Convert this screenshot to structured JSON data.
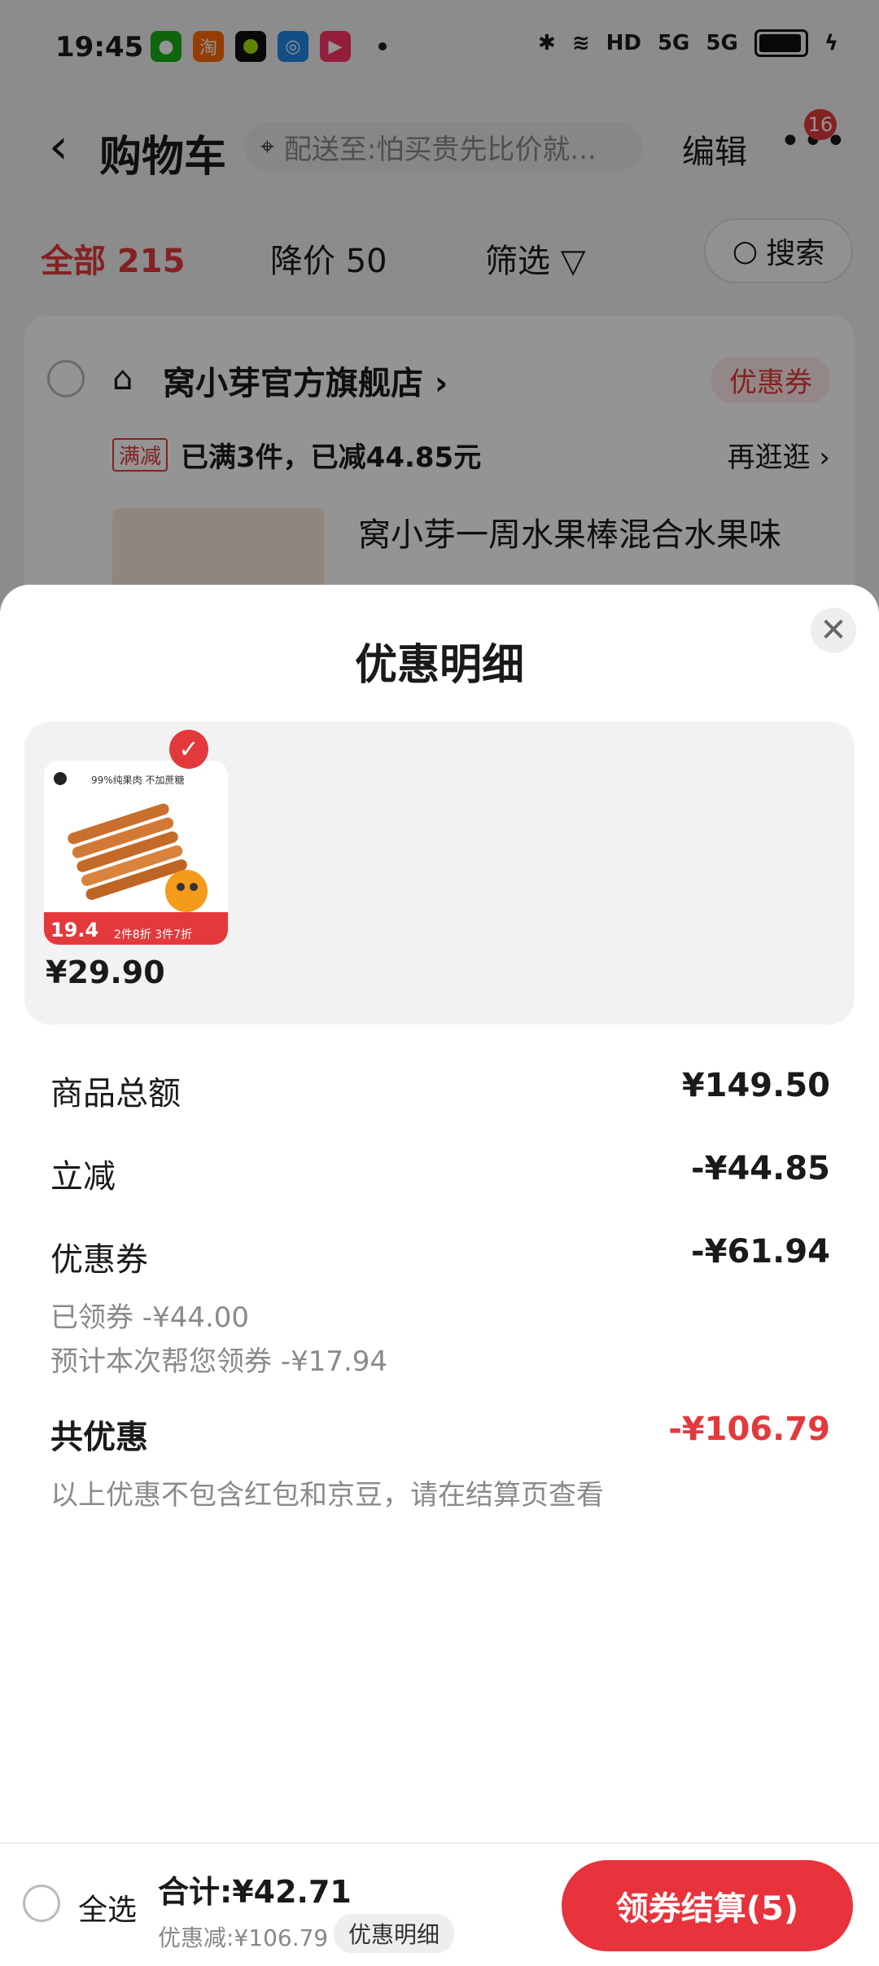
{
  "status_bar": {
    "time": "19:45",
    "network": "5G",
    "hd_label": "HD"
  },
  "nav": {
    "title": "购物车",
    "address": "配送至:怕买贵先比价就...",
    "edit": "编辑",
    "more_badge": "16"
  },
  "filters": {
    "all": "全部 215",
    "price_drop": "降价 50",
    "filter": "筛选",
    "search": "搜索"
  },
  "store": {
    "name": "窝小芽官方旗舰店",
    "coupon_tag": "优惠券",
    "promo_tag": "满减",
    "promo_text": "已满3件，已减44.85元",
    "more_link": "再逛逛",
    "product_title": "窝小芽一周水果棒混合水果味"
  },
  "sheet": {
    "title": "优惠明细",
    "product": {
      "price": "¥29.90",
      "img_text1": "99%纯果肉 不加蔗糖",
      "img_badge": "19.4",
      "img_promo": "2件8折 3件7折"
    },
    "rows": [
      {
        "label": "商品总额",
        "value": "¥149.50"
      },
      {
        "label": "立减",
        "value": "-¥44.85"
      },
      {
        "label": "优惠券",
        "value": "-¥61.94"
      }
    ],
    "coupon_sub": [
      "已领券 -¥44.00",
      "预计本次帮您领券 -¥17.94"
    ],
    "total_label": "共优惠",
    "total_value": "-¥106.79",
    "note": "以上优惠不包含红包和京豆，请在结算页查看"
  },
  "checkout": {
    "select_all": "全选",
    "total": "合计:¥42.71",
    "discount": "优惠减:¥106.79",
    "detail": "优惠明细",
    "button": "领券结算(5)"
  },
  "colors": {
    "accent": "#e4393c",
    "button": "#e8323c"
  }
}
